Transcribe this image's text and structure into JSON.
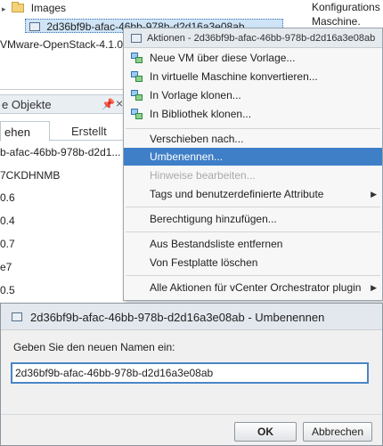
{
  "tree": {
    "images_label": "Images",
    "vm_label": "2d36bf9b-afac-46bb-978b-d2d16a3e08ab",
    "openstack_label": "VMware-OpenStack-4.1.0.0"
  },
  "right_info": {
    "line1": "Konfigurations",
    "line2": "Maschine."
  },
  "objects_panel": {
    "title": "e Objekte",
    "tabs": [
      "ehen",
      "Erstellt"
    ],
    "items": [
      "b-afac-46bb-978b-d2d1...",
      "7CKDHNMB",
      "0.6",
      "0.4",
      "0.7",
      "e7",
      "0.5"
    ]
  },
  "context_menu": {
    "title": "Aktionen - 2d36bf9b-afac-46bb-978b-d2d16a3e08ab",
    "items": [
      {
        "label": "Neue VM über diese Vorlage...",
        "icon": "new-vm-icon",
        "enabled": true
      },
      {
        "label": "In virtuelle Maschine konvertieren...",
        "icon": "convert-vm-icon",
        "enabled": true
      },
      {
        "label": "In Vorlage klonen...",
        "icon": "clone-template-icon",
        "enabled": true
      },
      {
        "label": "In Bibliothek klonen...",
        "icon": "clone-library-icon",
        "enabled": true
      },
      {
        "label": "Verschieben nach...",
        "enabled": true
      },
      {
        "label": "Umbenennen...",
        "enabled": true,
        "highlighted": true
      },
      {
        "label": "Hinweise bearbeiten...",
        "enabled": false
      },
      {
        "label": "Tags und benutzerdefinierte Attribute",
        "enabled": true,
        "submenu": true
      },
      {
        "label": "Berechtigung hinzufügen...",
        "enabled": true
      },
      {
        "label": "Aus Bestandsliste entfernen",
        "enabled": true
      },
      {
        "label": "Von Festplatte löschen",
        "enabled": true
      },
      {
        "label": "Alle Aktionen für vCenter Orchestrator plugin",
        "enabled": true,
        "submenu": true
      }
    ]
  },
  "rename_dialog": {
    "title": "2d36bf9b-afac-46bb-978b-d2d16a3e08ab - Umbenennen",
    "prompt": "Geben Sie den neuen Namen ein:",
    "name_value": "2d36bf9b-afac-46bb-978b-d2d16a3e08ab",
    "ok_label": "OK",
    "cancel_label": "Abbrechen"
  },
  "colors": {
    "highlight": "#3f7fc8",
    "selection": "#cfe4f7",
    "input_focus_border": "#4a86c6"
  }
}
